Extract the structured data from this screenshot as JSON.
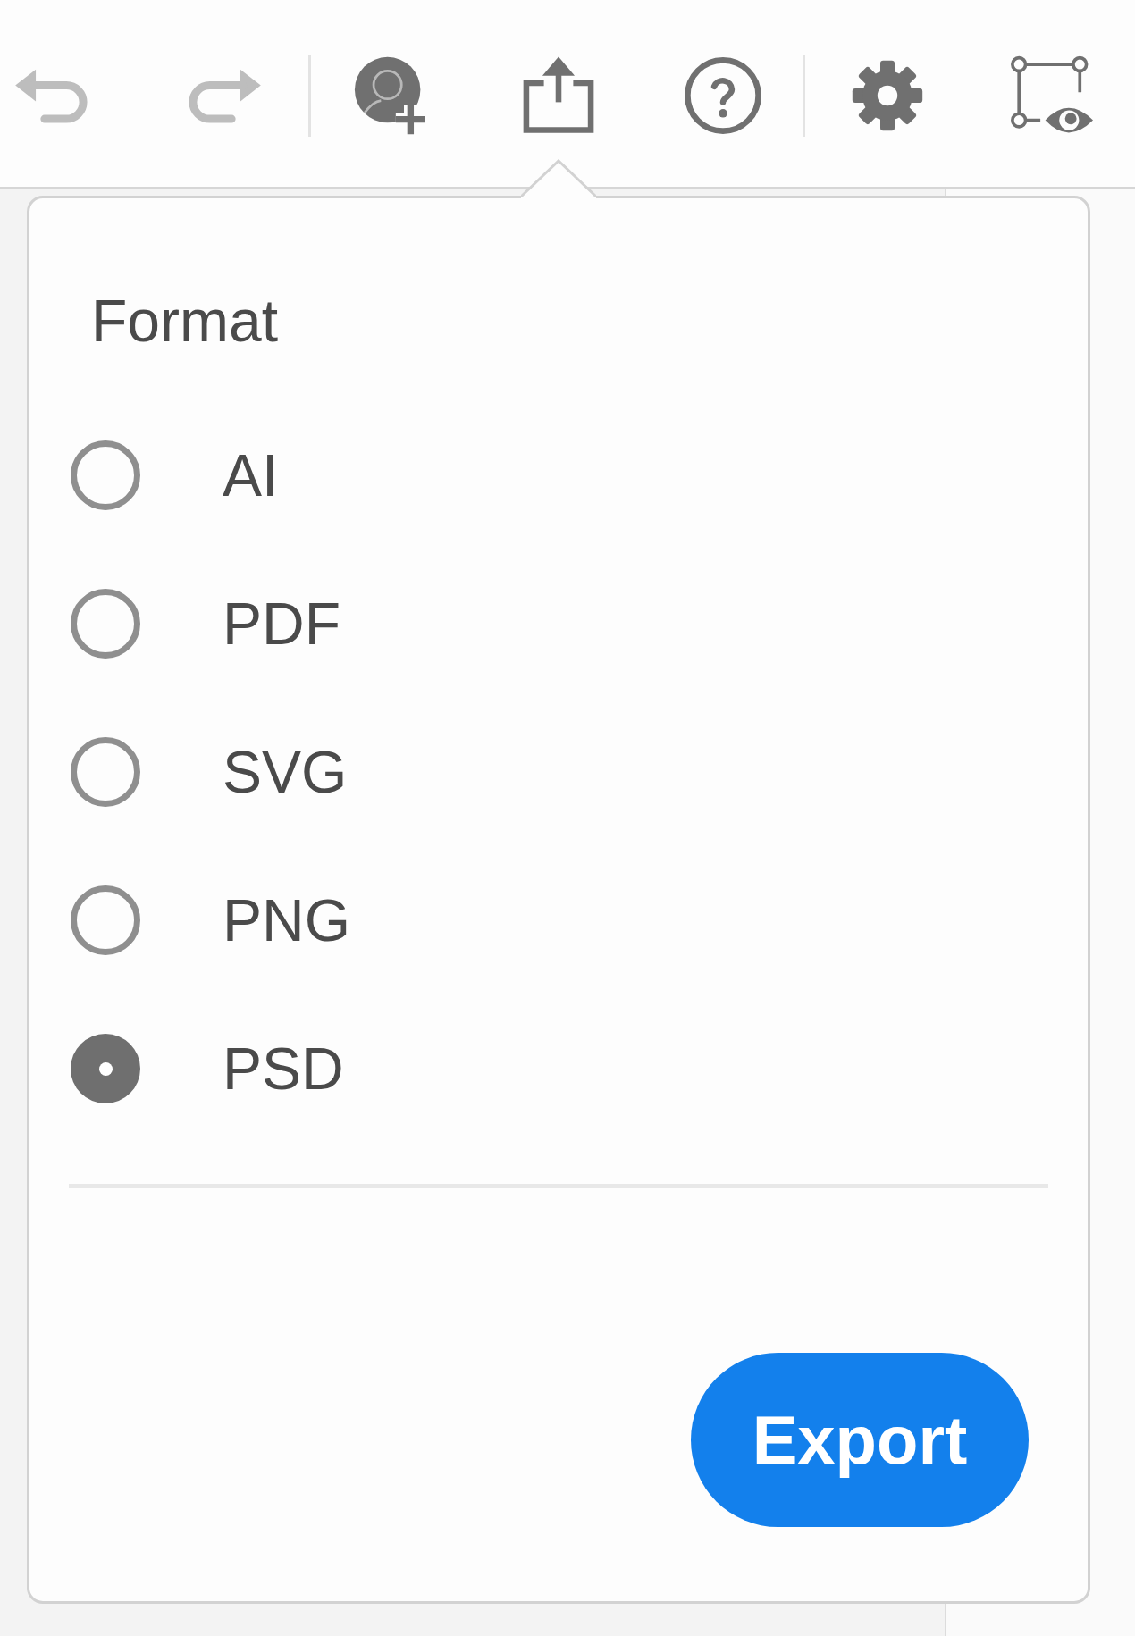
{
  "toolbar": {
    "undo": {
      "disabled": true
    },
    "redo": {
      "disabled": true
    }
  },
  "export_popover": {
    "title": "Format",
    "options": [
      {
        "label": "AI",
        "selected": false
      },
      {
        "label": "PDF",
        "selected": false
      },
      {
        "label": "SVG",
        "selected": false
      },
      {
        "label": "PNG",
        "selected": false
      },
      {
        "label": "PSD",
        "selected": true
      }
    ],
    "button": "Export"
  }
}
